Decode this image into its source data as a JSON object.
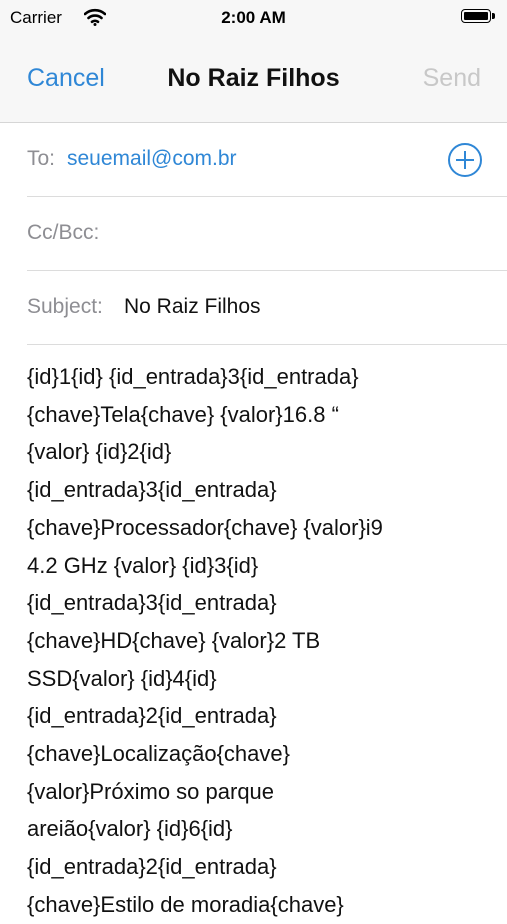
{
  "status_bar": {
    "carrier": "Carrier",
    "time": "2:00 AM"
  },
  "nav": {
    "cancel_label": "Cancel",
    "title": "No Raiz Filhos",
    "send_label": "Send"
  },
  "fields": {
    "to_label": "To:",
    "to_value": "seuemail@com.br",
    "ccbcc_label": "Cc/Bcc:",
    "subject_label": "Subject:",
    "subject_value": "No Raiz Filhos"
  },
  "body_lines": [
    "{id}1{id} {id_entrada}3{id_entrada}",
    "{chave}Tela{chave} {valor}16.8 “",
    "{valor} {id}2{id}",
    "{id_entrada}3{id_entrada}",
    "{chave}Processador{chave} {valor}i9",
    "4.2 GHz {valor} {id}3{id}",
    "{id_entrada}3{id_entrada}",
    "{chave}HD{chave} {valor}2 TB",
    "SSD{valor} {id}4{id}",
    "{id_entrada}2{id_entrada}",
    "{chave}Localização{chave}",
    "{valor}Próximo so parque",
    "areião{valor} {id}6{id}",
    "{id_entrada}2{id_entrada}",
    "{chave}Estilo de moradia{chave}"
  ],
  "colors": {
    "accent": "#2f87d6",
    "disabled": "#c8c8c8",
    "label_gray": "#8e8e93",
    "bar_background": "#f7f7f7"
  },
  "icons": {
    "wifi": "wifi-icon",
    "battery": "battery-icon",
    "add_contact": "add-contact-icon"
  }
}
